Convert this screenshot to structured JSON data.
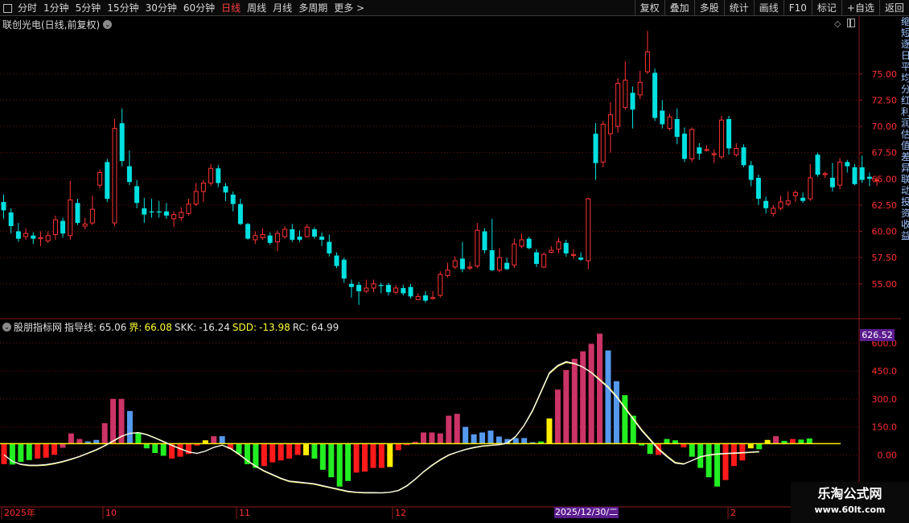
{
  "toolbar": {
    "left_items": [
      "分时",
      "1分钟",
      "5分钟",
      "15分钟",
      "30分钟",
      "60分钟",
      "日线",
      "周线",
      "月线",
      "多周期",
      "更多"
    ],
    "active_index": 6,
    "more_arrow": ">",
    "right_items": [
      "复权",
      "叠加",
      "多股",
      "统计",
      "画线",
      "F10",
      "标记",
      "+自选",
      "返回"
    ]
  },
  "stock": {
    "title": "联创光电(日线,前复权)",
    "dropdown_glyph": "⌄"
  },
  "price_axis": {
    "labels": [
      "75.00",
      "72.50",
      "70.00",
      "67.50",
      "65.00",
      "62.50",
      "60.00",
      "57.50",
      "55.00"
    ],
    "values": [
      75,
      72.5,
      70,
      67.5,
      65,
      62.5,
      60,
      57.5,
      55
    ],
    "range": [
      52.3,
      79.2
    ]
  },
  "indicator": {
    "name": "股朋指标网",
    "guide_label": "指导线:",
    "guide_value": "65.06",
    "jie_label": "界:",
    "jie_value": "66.08",
    "skk_label": "SKK:",
    "skk_value": "-16.24",
    "sdd_label": "SDD:",
    "sdd_value": "-13.98",
    "rc_label": "RC:",
    "rc_value": "64.99",
    "current_box": "626.52",
    "axis_labels": [
      "600.0",
      "450.0",
      "300.0",
      "150.0",
      "0.00"
    ],
    "axis_values": [
      600,
      450,
      300,
      150,
      0
    ],
    "range": [
      -270,
      640
    ]
  },
  "x_axis": {
    "labels": [
      {
        "text": "2025年",
        "pos": 5
      },
      {
        "text": "10",
        "pos": 131
      },
      {
        "text": "11",
        "pos": 297
      },
      {
        "text": "12",
        "pos": 491
      },
      {
        "text": "2",
        "pos": 908
      }
    ],
    "cursor_date": "2025/12/30/二"
  },
  "watermark": {
    "line1": "乐淘公式网",
    "line2": "www.60lt.com"
  },
  "side_strip_text": "缩短逐日平均分红利润估值差异联动投资收益",
  "colors": {
    "up": "#ff3333",
    "down": "#00e0e0",
    "bar_red": "#ff1a1a",
    "bar_green": "#22ee22",
    "bar_pink": "#cc3366",
    "bar_blue": "#5599ee",
    "bar_yellow": "#ffee00",
    "active": "#ff4040",
    "purple": "#5b1c8f"
  },
  "chart_data": {
    "type": "candlestick",
    "candles": [
      [
        62.8,
        62.0,
        63.5,
        61.2
      ],
      [
        61.8,
        60.5,
        62.2,
        59.8
      ],
      [
        60.0,
        59.3,
        60.8,
        59.0
      ],
      [
        59.5,
        59.8,
        60.3,
        59.2
      ],
      [
        59.6,
        59.3,
        59.9,
        58.8
      ],
      [
        59.3,
        59.4,
        60.0,
        58.6
      ],
      [
        59.1,
        59.6,
        60.0,
        58.9
      ],
      [
        59.7,
        61.1,
        61.5,
        59.2
      ],
      [
        61.0,
        59.8,
        61.3,
        59.4
      ],
      [
        59.6,
        63.0,
        64.8,
        59.2
      ],
      [
        62.7,
        60.8,
        63.1,
        60.6
      ],
      [
        60.5,
        60.7,
        61.3,
        60.2
      ],
      [
        60.8,
        62.1,
        63.4,
        60.6
      ],
      [
        64.4,
        65.6,
        65.9,
        64.1
      ],
      [
        66.6,
        63.1,
        66.9,
        62.8
      ],
      [
        60.8,
        69.8,
        70.7,
        60.5
      ],
      [
        70.3,
        66.7,
        71.7,
        66.2
      ],
      [
        66.2,
        64.7,
        67.7,
        64.4
      ],
      [
        64.3,
        62.7,
        64.9,
        62.2
      ],
      [
        62.2,
        61.6,
        63.2,
        60.8
      ],
      [
        61.9,
        61.8,
        63.1,
        61.3
      ],
      [
        61.9,
        61.8,
        62.9,
        61.3
      ],
      [
        61.9,
        61.5,
        62.7,
        61.2
      ],
      [
        61.2,
        61.6,
        61.9,
        60.4
      ],
      [
        61.3,
        61.8,
        62.3,
        61.0
      ],
      [
        61.7,
        62.6,
        63.1,
        61.5
      ],
      [
        62.6,
        63.8,
        64.6,
        62.4
      ],
      [
        63.8,
        64.6,
        64.9,
        62.8
      ],
      [
        64.6,
        66.0,
        66.4,
        64.3
      ],
      [
        66.0,
        64.6,
        66.3,
        64.2
      ],
      [
        64.3,
        63.7,
        64.6,
        62.9
      ],
      [
        63.5,
        62.6,
        63.8,
        61.9
      ],
      [
        62.6,
        60.7,
        63.1,
        60.6
      ],
      [
        60.7,
        59.3,
        60.8,
        59.2
      ],
      [
        59.2,
        59.6,
        60.0,
        58.8
      ],
      [
        59.4,
        59.7,
        60.3,
        59.2
      ],
      [
        59.6,
        58.9,
        59.9,
        58.7
      ],
      [
        59.0,
        59.8,
        60.1,
        58.1
      ],
      [
        59.5,
        60.2,
        60.5,
        59.3
      ],
      [
        60.2,
        59.2,
        60.7,
        59.0
      ],
      [
        59.5,
        59.2,
        60.1,
        59.0
      ],
      [
        59.5,
        60.4,
        60.7,
        59.4
      ],
      [
        60.2,
        59.5,
        60.4,
        59.3
      ],
      [
        59.5,
        59.2,
        59.9,
        58.6
      ],
      [
        59.0,
        57.9,
        59.7,
        57.6
      ],
      [
        57.7,
        56.7,
        58.0,
        56.5
      ],
      [
        57.3,
        55.5,
        57.5,
        55.1
      ],
      [
        55.0,
        54.7,
        55.4,
        53.7
      ],
      [
        54.9,
        54.3,
        55.2,
        53.0
      ],
      [
        54.3,
        54.6,
        55.4,
        54.1
      ],
      [
        54.6,
        55.0,
        55.4,
        54.2
      ],
      [
        54.9,
        54.8,
        55.1,
        54.1
      ],
      [
        54.9,
        54.2,
        55.1,
        53.9
      ],
      [
        54.2,
        54.6,
        54.9,
        54.0
      ],
      [
        54.6,
        54.1,
        54.9,
        53.9
      ],
      [
        54.7,
        53.8,
        55.0,
        53.6
      ],
      [
        53.5,
        53.8,
        54.1,
        53.6
      ],
      [
        53.9,
        53.4,
        54.3,
        53.2
      ],
      [
        53.6,
        53.7,
        54.3,
        53.5
      ],
      [
        53.9,
        55.9,
        56.2,
        53.7
      ],
      [
        55.8,
        56.3,
        57.0,
        55.6
      ],
      [
        56.6,
        57.2,
        57.6,
        56.4
      ],
      [
        57.4,
        56.4,
        59.0,
        56.1
      ],
      [
        56.5,
        56.6,
        57.1,
        56.3
      ],
      [
        56.7,
        60.1,
        60.8,
        56.5
      ],
      [
        60.0,
        58.2,
        60.3,
        57.9
      ],
      [
        58.2,
        56.3,
        61.2,
        56.2
      ],
      [
        56.3,
        57.5,
        58.4,
        56.1
      ],
      [
        57.0,
        56.4,
        57.5,
        56.3
      ],
      [
        56.8,
        58.8,
        59.3,
        56.5
      ],
      [
        58.6,
        59.2,
        59.8,
        58.4
      ],
      [
        59.3,
        58.4,
        59.5,
        58.3
      ],
      [
        58.0,
        56.9,
        58.3,
        56.6
      ],
      [
        56.6,
        57.8,
        58.0,
        56.5
      ],
      [
        58.0,
        58.2,
        58.6,
        57.9
      ],
      [
        58.3,
        59.0,
        59.4,
        57.9
      ],
      [
        58.9,
        57.9,
        59.2,
        57.6
      ],
      [
        57.7,
        57.8,
        58.3,
        57.4
      ],
      [
        57.5,
        57.3,
        58.0,
        57.2
      ],
      [
        57.2,
        63.1,
        63.2,
        56.4
      ],
      [
        69.3,
        66.5,
        70.3,
        64.9
      ],
      [
        66.6,
        70.2,
        70.5,
        66.1
      ],
      [
        69.3,
        71.1,
        72.3,
        67.5
      ],
      [
        70.0,
        74.1,
        74.6,
        69.4
      ],
      [
        71.8,
        74.4,
        76.2,
        71.6
      ],
      [
        73.2,
        71.6,
        73.8,
        69.8
      ],
      [
        73.0,
        74.2,
        75.3,
        72.6
      ],
      [
        75.2,
        77.1,
        79.1,
        75.0
      ],
      [
        75.1,
        70.8,
        75.5,
        70.5
      ],
      [
        71.5,
        70.2,
        72.5,
        69.8
      ],
      [
        69.8,
        70.9,
        71.2,
        69.6
      ],
      [
        70.7,
        69.0,
        71.7,
        68.3
      ],
      [
        69.3,
        66.9,
        69.9,
        66.6
      ],
      [
        66.9,
        69.7,
        69.9,
        66.6
      ],
      [
        68.0,
        67.4,
        68.4,
        66.8
      ],
      [
        67.7,
        67.8,
        68.2,
        67.6
      ],
      [
        67.3,
        67.4,
        67.8,
        66.5
      ],
      [
        67.1,
        70.6,
        71.0,
        66.9
      ],
      [
        70.7,
        67.9,
        71.0,
        67.3
      ],
      [
        67.3,
        67.9,
        68.4,
        67.1
      ],
      [
        68.0,
        66.3,
        68.3,
        66.1
      ],
      [
        66.3,
        64.9,
        66.7,
        64.3
      ],
      [
        65.1,
        63.1,
        65.4,
        62.5
      ],
      [
        62.9,
        62.2,
        63.3,
        61.7
      ],
      [
        61.7,
        62.2,
        62.5,
        61.4
      ],
      [
        62.2,
        62.8,
        63.4,
        62.0
      ],
      [
        62.6,
        62.9,
        63.8,
        62.4
      ],
      [
        63.4,
        63.7,
        63.9,
        62.8
      ],
      [
        63.2,
        62.9,
        63.7,
        62.7
      ],
      [
        63.1,
        65.1,
        66.4,
        62.9
      ],
      [
        67.3,
        65.4,
        67.5,
        65.2
      ],
      [
        65.4,
        65.5,
        65.7,
        65.1
      ],
      [
        65.1,
        64.2,
        66.5,
        63.8
      ],
      [
        64.4,
        66.6,
        67.0,
        64.0
      ],
      [
        66.6,
        66.2,
        66.8,
        65.6
      ],
      [
        66.1,
        64.5,
        66.4,
        64.4
      ],
      [
        66.1,
        64.9,
        67.2,
        64.6
      ],
      [
        65.2,
        65.0,
        65.6,
        64.3
      ],
      [
        64.9,
        64.9,
        65.2,
        64.3
      ]
    ],
    "indicator_bars": [
      [
        -110,
        "red"
      ],
      [
        -112,
        "green"
      ],
      [
        -98,
        "green"
      ],
      [
        -88,
        "green"
      ],
      [
        -80,
        "red"
      ],
      [
        -75,
        "red"
      ],
      [
        -60,
        "red"
      ],
      [
        -22,
        "pink"
      ],
      [
        55,
        "pink"
      ],
      [
        25,
        "pink"
      ],
      [
        12,
        "blue"
      ],
      [
        20,
        "blue"
      ],
      [
        110,
        "pink"
      ],
      [
        240,
        "pink"
      ],
      [
        240,
        "pink"
      ],
      [
        175,
        "blue"
      ],
      [
        60,
        "green"
      ],
      [
        -25,
        "green"
      ],
      [
        -50,
        "green"
      ],
      [
        -65,
        "green"
      ],
      [
        -80,
        "red"
      ],
      [
        -70,
        "red"
      ],
      [
        -55,
        "red"
      ],
      [
        -10,
        "red"
      ],
      [
        18,
        "yellow"
      ],
      [
        40,
        "pink"
      ],
      [
        40,
        "blue"
      ],
      [
        -28,
        "red"
      ],
      [
        -55,
        "green"
      ],
      [
        -110,
        "green"
      ],
      [
        -130,
        "green"
      ],
      [
        -120,
        "red"
      ],
      [
        -100,
        "red"
      ],
      [
        -90,
        "red"
      ],
      [
        -80,
        "red"
      ],
      [
        -60,
        "red"
      ],
      [
        -62,
        "yellow"
      ],
      [
        -80,
        "green"
      ],
      [
        -140,
        "green"
      ],
      [
        -180,
        "green"
      ],
      [
        -230,
        "green"
      ],
      [
        -200,
        "green"
      ],
      [
        -155,
        "red"
      ],
      [
        -150,
        "red"
      ],
      [
        -130,
        "red"
      ],
      [
        -130,
        "red"
      ],
      [
        -125,
        "yellow"
      ],
      [
        -35,
        "red"
      ],
      [
        -8,
        "red"
      ],
      [
        10,
        "pink"
      ],
      [
        60,
        "pink"
      ],
      [
        60,
        "pink"
      ],
      [
        55,
        "pink"
      ],
      [
        150,
        "pink"
      ],
      [
        160,
        "pink"
      ],
      [
        90,
        "blue"
      ],
      [
        50,
        "blue"
      ],
      [
        60,
        "blue"
      ],
      [
        70,
        "blue"
      ],
      [
        38,
        "blue"
      ],
      [
        25,
        "blue"
      ],
      [
        30,
        "blue"
      ],
      [
        30,
        "blue"
      ],
      [
        8,
        "blue"
      ],
      [
        12,
        "green"
      ],
      [
        135,
        "yellow"
      ],
      [
        290,
        "pink"
      ],
      [
        395,
        "pink"
      ],
      [
        455,
        "pink"
      ],
      [
        495,
        "pink"
      ],
      [
        535,
        "pink"
      ],
      [
        590,
        "pink"
      ],
      [
        500,
        "blue"
      ],
      [
        335,
        "blue"
      ],
      [
        260,
        "green"
      ],
      [
        150,
        "green"
      ],
      [
        -10,
        "green"
      ],
      [
        -55,
        "green"
      ],
      [
        -60,
        "red"
      ],
      [
        25,
        "green"
      ],
      [
        18,
        "green"
      ],
      [
        -20,
        "red"
      ],
      [
        -70,
        "green"
      ],
      [
        -130,
        "green"
      ],
      [
        -180,
        "green"
      ],
      [
        -230,
        "green"
      ],
      [
        -195,
        "red"
      ],
      [
        -120,
        "red"
      ],
      [
        -90,
        "red"
      ],
      [
        -25,
        "yellow"
      ],
      [
        -30,
        "green"
      ],
      [
        20,
        "yellow"
      ],
      [
        40,
        "pink"
      ],
      [
        15,
        "green"
      ],
      [
        25,
        "red"
      ],
      [
        22,
        "green"
      ],
      [
        28,
        "green"
      ]
    ],
    "guide_line": [
      -60,
      -95,
      -110,
      -115,
      -115,
      -112,
      -105,
      -95,
      -82,
      -68,
      -50,
      -32,
      -10,
      15,
      40,
      55,
      58,
      48,
      30,
      10,
      -10,
      -28,
      -45,
      -52,
      -40,
      -20,
      -8,
      -25,
      -55,
      -90,
      -120,
      -145,
      -165,
      -185,
      -200,
      -205,
      -210,
      -215,
      -225,
      -235,
      -245,
      -255,
      -260,
      -262,
      -262,
      -263,
      -260,
      -250,
      -225,
      -190,
      -150,
      -115,
      -85,
      -60,
      -45,
      -30,
      -20,
      -12,
      -8,
      -5,
      5,
      40,
      100,
      180,
      280,
      380,
      420,
      440,
      430,
      410,
      380,
      340,
      300,
      250,
      190,
      130,
      70,
      20,
      -30,
      -70,
      -105,
      -110,
      -90,
      -70,
      -60,
      -55,
      -52,
      -50,
      -48,
      -45,
      -42
    ],
    "jie_line": [
      -60,
      -95,
      -112,
      -118,
      -118,
      -115,
      -108,
      -98,
      -85,
      -70,
      -52,
      -35,
      -12,
      12,
      38,
      55,
      60,
      50,
      32,
      12,
      -8,
      -26,
      -44,
      -52,
      -40,
      -20,
      -8,
      -28,
      -58,
      -92,
      -122,
      -148,
      -168,
      -188,
      -203,
      -208,
      -212,
      -218,
      -228,
      -238,
      -248,
      -258,
      -262,
      -264,
      -264,
      -264,
      -261,
      -252,
      -228,
      -192,
      -152,
      -118,
      -88,
      -62,
      -46,
      -32,
      -22,
      -14,
      -10,
      -6,
      2,
      38,
      98,
      175,
      275,
      375,
      415,
      435,
      428,
      410,
      382,
      345,
      305,
      255,
      195,
      135,
      75,
      25,
      -25,
      -65,
      -100,
      -108,
      -90,
      -72,
      -62,
      -57,
      -54,
      -52,
      -50,
      -47,
      -44
    ],
    "title_prefix_circle": "⌄"
  }
}
